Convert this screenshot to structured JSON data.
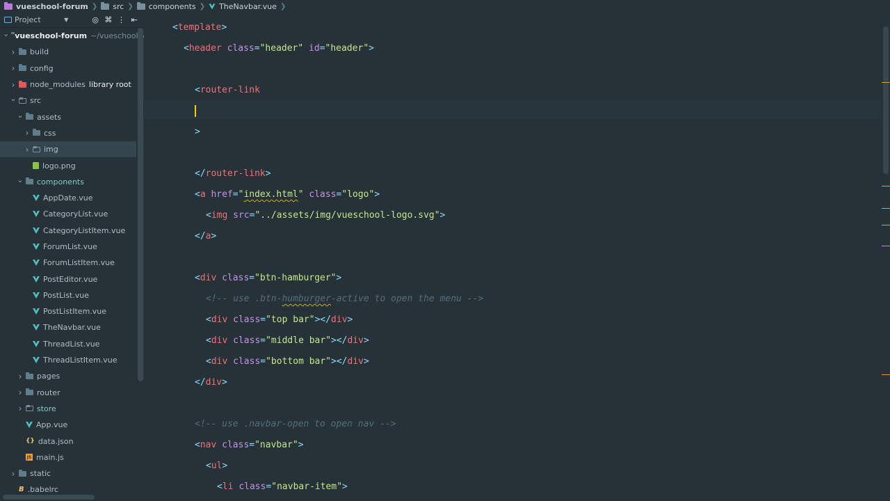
{
  "breadcrumb": [
    {
      "label": "vueschool-forum",
      "icon": "project-folder-icon",
      "color": "#b97bd6"
    },
    {
      "label": "src",
      "icon": "folder-icon",
      "color": "#78909c"
    },
    {
      "label": "components",
      "icon": "folder-icon",
      "color": "#78909c"
    },
    {
      "label": "TheNavbar.vue",
      "icon": "vue-file-icon",
      "color": "#4fc3c7"
    }
  ],
  "project_panel": {
    "title": "Project",
    "tools": [
      "target-icon",
      "collapse-icon",
      "more-icon",
      "hide-icon"
    ],
    "tree": [
      {
        "label": "vueschool-forum",
        "hint": "~/vueschool/v",
        "depth": 0,
        "expanded": true,
        "type": "project"
      },
      {
        "label": "build",
        "depth": 1,
        "expanded": false,
        "type": "folder"
      },
      {
        "label": "config",
        "depth": 1,
        "expanded": false,
        "type": "folder"
      },
      {
        "label": "node_modules",
        "hint": "library root",
        "depth": 1,
        "expanded": false,
        "type": "folder-red"
      },
      {
        "label": "src",
        "depth": 1,
        "expanded": true,
        "type": "folder-src"
      },
      {
        "label": "assets",
        "depth": 2,
        "expanded": true,
        "type": "folder"
      },
      {
        "label": "css",
        "depth": 3,
        "expanded": false,
        "type": "folder"
      },
      {
        "label": "img",
        "depth": 3,
        "expanded": false,
        "type": "folder-src",
        "selected": true
      },
      {
        "label": "logo.png",
        "depth": 3,
        "type": "image"
      },
      {
        "label": "components",
        "depth": 2,
        "expanded": true,
        "type": "folder",
        "accent": true
      },
      {
        "label": "AppDate.vue",
        "depth": 3,
        "type": "vue"
      },
      {
        "label": "CategoryList.vue",
        "depth": 3,
        "type": "vue"
      },
      {
        "label": "CategoryListItem.vue",
        "depth": 3,
        "type": "vue"
      },
      {
        "label": "ForumList.vue",
        "depth": 3,
        "type": "vue"
      },
      {
        "label": "ForumListItem.vue",
        "depth": 3,
        "type": "vue"
      },
      {
        "label": "PostEditor.vue",
        "depth": 3,
        "type": "vue"
      },
      {
        "label": "PostList.vue",
        "depth": 3,
        "type": "vue"
      },
      {
        "label": "PostListItem.vue",
        "depth": 3,
        "type": "vue"
      },
      {
        "label": "TheNavbar.vue",
        "depth": 3,
        "type": "vue"
      },
      {
        "label": "ThreadList.vue",
        "depth": 3,
        "type": "vue"
      },
      {
        "label": "ThreadListItem.vue",
        "depth": 3,
        "type": "vue"
      },
      {
        "label": "pages",
        "depth": 2,
        "expanded": false,
        "type": "folder"
      },
      {
        "label": "router",
        "depth": 2,
        "expanded": false,
        "type": "folder"
      },
      {
        "label": "store",
        "depth": 2,
        "expanded": false,
        "type": "folder-src",
        "accent": true
      },
      {
        "label": "App.vue",
        "depth": 2,
        "type": "vue"
      },
      {
        "label": "data.json",
        "depth": 2,
        "type": "json"
      },
      {
        "label": "main.js",
        "depth": 2,
        "type": "js"
      },
      {
        "label": "static",
        "depth": 1,
        "expanded": false,
        "type": "folder"
      },
      {
        "label": ".babelrc",
        "depth": 1,
        "type": "babel"
      }
    ]
  },
  "editor": {
    "file": "TheNavbar.vue",
    "lines": [
      {
        "indent": 0,
        "tokens": [
          [
            "p",
            "<"
          ],
          [
            "t",
            "template"
          ],
          [
            "p",
            ">"
          ]
        ]
      },
      {
        "indent": 1,
        "tokens": [
          [
            "p",
            "<"
          ],
          [
            "t",
            "header "
          ],
          [
            "a",
            "class"
          ],
          [
            "p",
            "="
          ],
          [
            "s",
            "\"header\""
          ],
          [
            "p",
            " "
          ],
          [
            "a",
            "id"
          ],
          [
            "p",
            "="
          ],
          [
            "s",
            "\"header\""
          ],
          [
            "p",
            ">"
          ]
        ]
      },
      {
        "indent": 0,
        "tokens": []
      },
      {
        "indent": 2,
        "tokens": [
          [
            "p",
            "<"
          ],
          [
            "t",
            "router-link"
          ]
        ]
      },
      {
        "indent": 2,
        "tokens": [],
        "caret": true
      },
      {
        "indent": 2,
        "tokens": [
          [
            "p",
            ">"
          ]
        ]
      },
      {
        "indent": 0,
        "tokens": []
      },
      {
        "indent": 2,
        "tokens": [
          [
            "p",
            "</"
          ],
          [
            "t",
            "router-link"
          ],
          [
            "p",
            ">"
          ]
        ]
      },
      {
        "indent": 2,
        "tokens": [
          [
            "p",
            "<"
          ],
          [
            "t",
            "a "
          ],
          [
            "a",
            "href"
          ],
          [
            "p",
            "="
          ],
          [
            "s",
            "\""
          ],
          [
            "sq",
            "index.html"
          ],
          [
            "s",
            "\""
          ],
          [
            "p",
            " "
          ],
          [
            "a",
            "class"
          ],
          [
            "p",
            "="
          ],
          [
            "s",
            "\"logo\""
          ],
          [
            "p",
            ">"
          ]
        ]
      },
      {
        "indent": 3,
        "tokens": [
          [
            "p",
            "<"
          ],
          [
            "t",
            "img "
          ],
          [
            "a",
            "src"
          ],
          [
            "p",
            "="
          ],
          [
            "s",
            "\"../assets/img/vueschool-logo.svg\""
          ],
          [
            "p",
            ">"
          ]
        ]
      },
      {
        "indent": 2,
        "tokens": [
          [
            "p",
            "</"
          ],
          [
            "t",
            "a"
          ],
          [
            "p",
            ">"
          ]
        ]
      },
      {
        "indent": 0,
        "tokens": []
      },
      {
        "indent": 2,
        "tokens": [
          [
            "p",
            "<"
          ],
          [
            "t",
            "div "
          ],
          [
            "a",
            "class"
          ],
          [
            "p",
            "="
          ],
          [
            "s",
            "\"btn-hamburger\""
          ],
          [
            "p",
            ">"
          ]
        ]
      },
      {
        "indent": 3,
        "tokens": [
          [
            "c",
            "<!-- use .btn-"
          ],
          [
            "csq",
            "humburger"
          ],
          [
            "c",
            "-active to open the menu -->"
          ]
        ]
      },
      {
        "indent": 3,
        "tokens": [
          [
            "p",
            "<"
          ],
          [
            "t",
            "div "
          ],
          [
            "a",
            "class"
          ],
          [
            "p",
            "="
          ],
          [
            "s",
            "\"top bar\""
          ],
          [
            "p",
            ">"
          ],
          [
            "p",
            "</"
          ],
          [
            "t",
            "div"
          ],
          [
            "p",
            ">"
          ]
        ]
      },
      {
        "indent": 3,
        "tokens": [
          [
            "p",
            "<"
          ],
          [
            "t",
            "div "
          ],
          [
            "a",
            "class"
          ],
          [
            "p",
            "="
          ],
          [
            "s",
            "\"middle bar\""
          ],
          [
            "p",
            ">"
          ],
          [
            "p",
            "</"
          ],
          [
            "t",
            "div"
          ],
          [
            "p",
            ">"
          ]
        ]
      },
      {
        "indent": 3,
        "tokens": [
          [
            "p",
            "<"
          ],
          [
            "t",
            "div "
          ],
          [
            "a",
            "class"
          ],
          [
            "p",
            "="
          ],
          [
            "s",
            "\"bottom bar\""
          ],
          [
            "p",
            ">"
          ],
          [
            "p",
            "</"
          ],
          [
            "t",
            "div"
          ],
          [
            "p",
            ">"
          ]
        ]
      },
      {
        "indent": 2,
        "tokens": [
          [
            "p",
            "</"
          ],
          [
            "t",
            "div"
          ],
          [
            "p",
            ">"
          ]
        ]
      },
      {
        "indent": 0,
        "tokens": []
      },
      {
        "indent": 2,
        "tokens": [
          [
            "c",
            "<!-- use .navbar-open to open nav -->"
          ]
        ]
      },
      {
        "indent": 2,
        "tokens": [
          [
            "p",
            "<"
          ],
          [
            "t",
            "nav "
          ],
          [
            "a",
            "class"
          ],
          [
            "p",
            "="
          ],
          [
            "s",
            "\"navbar\""
          ],
          [
            "p",
            ">"
          ]
        ]
      },
      {
        "indent": 3,
        "tokens": [
          [
            "p",
            "<"
          ],
          [
            "t",
            "ul"
          ],
          [
            "p",
            ">"
          ]
        ]
      },
      {
        "indent": 4,
        "tokens": [
          [
            "p",
            "<"
          ],
          [
            "t",
            "li "
          ],
          [
            "a",
            "class"
          ],
          [
            "p",
            "="
          ],
          [
            "s",
            "\"navbar-item\""
          ],
          [
            "p",
            ">"
          ]
        ]
      }
    ],
    "gutter_marks": [
      {
        "pos": 0.143,
        "color": "#d9a03a"
      },
      {
        "pos": 0.355,
        "color": "#d9a03a"
      },
      {
        "pos": 0.4,
        "color": "#d9a03a"
      },
      {
        "pos": 0.435,
        "color": "#d9a03a"
      },
      {
        "pos": 0.477,
        "color": "#d9a03a"
      },
      {
        "pos": 0.741,
        "color": "#d9a03a"
      }
    ]
  }
}
